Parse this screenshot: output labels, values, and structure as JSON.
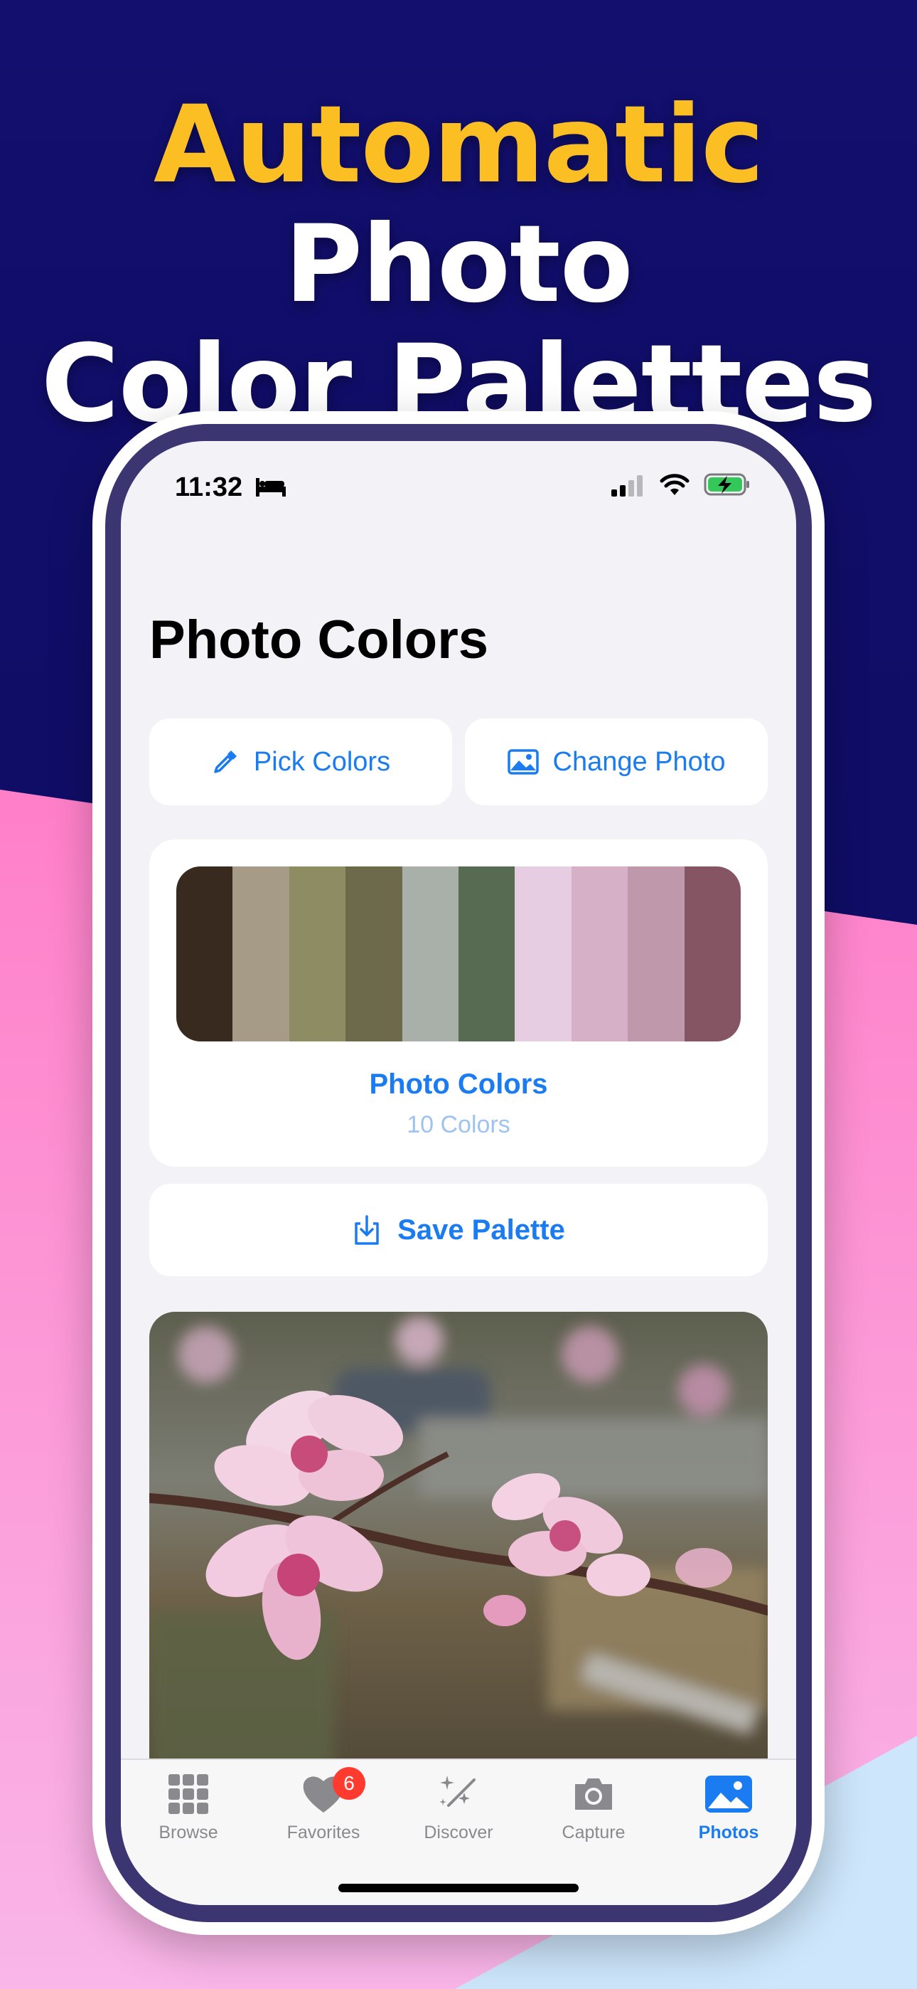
{
  "headline": {
    "accent": "Automatic",
    "rest_line1": " Photo",
    "line2": "Color Palettes"
  },
  "status_bar": {
    "time": "11:32"
  },
  "page_title": "Photo Colors",
  "actions": {
    "pick_colors": "Pick Colors",
    "change_photo": "Change Photo"
  },
  "palette": {
    "name": "Photo Colors",
    "count_label": "10 Colors",
    "swatches": [
      "#382a1f",
      "#a69b86",
      "#8d8c62",
      "#6d6a4c",
      "#a9b0a9",
      "#566b52",
      "#e6cde1",
      "#d5b0c7",
      "#bf98ab",
      "#855563"
    ]
  },
  "save_palette": "Save Palette",
  "tabs": [
    {
      "label": "Browse",
      "icon": "grid-icon"
    },
    {
      "label": "Favorites",
      "icon": "heart-icon",
      "badge": "6"
    },
    {
      "label": "Discover",
      "icon": "sparkles-icon"
    },
    {
      "label": "Capture",
      "icon": "camera-icon"
    },
    {
      "label": "Photos",
      "icon": "photo-icon",
      "active": true
    }
  ],
  "colors": {
    "accent_blue": "#1a7cf0",
    "headline_yellow": "#fbbf24",
    "bg_navy": "#0e0b66",
    "bg_pink": "#ff86d4",
    "badge_red": "#ff3b30"
  }
}
